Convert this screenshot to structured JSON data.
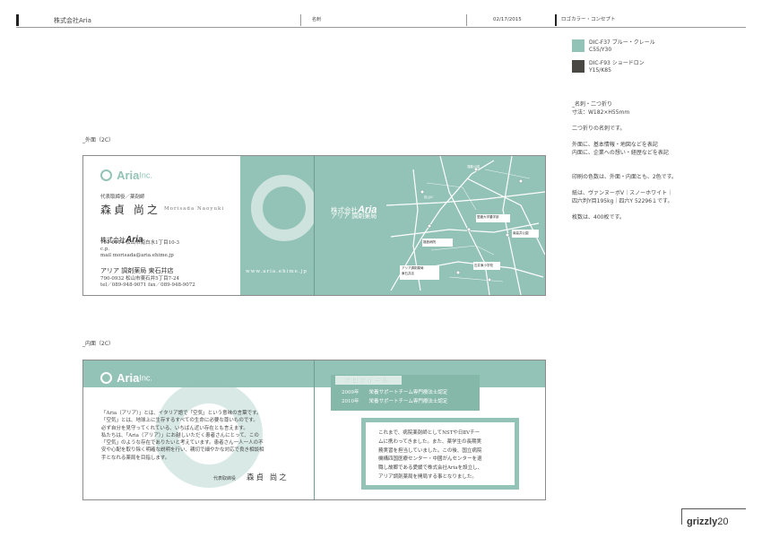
{
  "header": {
    "company": "株式会社Aria",
    "doc_type": "名刺",
    "date": "02/17/2015",
    "section": "ロゴカラー・コンセプト"
  },
  "colors": {
    "swatch1": "#93c2b6",
    "swatch2": "#4a4843",
    "teal": "#93c2b6",
    "teal_dark": "#86b8aa"
  },
  "swatches": [
    {
      "line1": "DIC-F37 ブルー・クレール",
      "line2": "C55/Y30"
    },
    {
      "line1": "DIC-F93 ショードロン",
      "line2": "Y15/K85"
    }
  ],
  "specs": {
    "size_label": "_名刺・二つ折り",
    "size_value": "寸法：W182×H55mm",
    "fold": "二つ折りの名刺です。",
    "outside1": "外面に、基本情報・地図などを表記",
    "inside1": "内面に、企業への想い・経歴などを表記",
    "color_count": "印刷の色数は、外面・内面とも、2色です。",
    "paper1": "紙は、ヴァンヌーボV｜スノーホワイト｜",
    "paper2": "四六判Y目195kg｜四六Y 52296１です。",
    "quantity": "枚数は、400枚です。"
  },
  "outer": {
    "label": "_外面（2C）",
    "logo": "Aria",
    "logo_suffix": "Inc.",
    "title_small": "代表取締役／薬剤師",
    "name": "森貞 尚之",
    "name_roman": "Morisada Naoyuki",
    "company_prefix": "株式会社",
    "company_brand": "Aria",
    "address1": "791-0114 松山市南白水1丁目10-3",
    "address2": "c.p.",
    "address3": "mail  morisada@aria.ehime.jp",
    "pharmacy": "アリア 調剤薬局 東石井店",
    "pharmacy_addr": "790-0932 松山市東石井5丁目7-24",
    "pharmacy_tel": "tel／089-948-9071  fax／089-948-9072",
    "cover_company_prefix": "株式会社",
    "cover_company_brand": "Aria",
    "cover_pharmacy": "アリア 調剤薬局",
    "url": "www.aria.ehime.jp",
    "map_labels": [
      "運動公園",
      "松山IC",
      "愛媛大学農学部",
      "アリア調剤薬局",
      "東石井店",
      "南高井公園",
      "福音病院",
      "石井東小学校"
    ]
  },
  "inner": {
    "label": "_内面（2C）",
    "logo": "Aria",
    "logo_suffix": "Inc.",
    "paragraph": [
      "「Aria（アリア）」とは、イタリア語で「空気」という意味の言葉です。",
      "「空気」とは、地球上に生存するすべての生命に必要な尊いものです。",
      "必ず自分を見守ってくれている、いちばん近い存在とも言えます。",
      "私たちは、「Aria（アリア）」にお越しいただく患者さんにとって、この",
      "「空気」のような存在でありたいと考えています。患者さん一人一人の不",
      "安や心配を取り除く明確な説明を行い、親切で細やかな対応で良き相談相",
      "手となれる薬局を目指します。"
    ],
    "signature_title": "代表取締役",
    "signature_name": "森貞 尚之",
    "profile_title": "プロフィール",
    "profile_items": [
      "2009年　　栄養サポートチーム専門療法士認定",
      "2010年　　栄養サポートチーム専門療法士認定"
    ],
    "bio": [
      "これまで、病院薬剤師としてNSTや日ⅡVチー",
      "ムに携わってきました。また、薬学生の長期実",
      "務実習を担当していました。この後、国立病院",
      "機構四国医療センター・中國がんセンターを退",
      "職し故郷である愛媛で株式会社Ariaを設立し、",
      "アリア調剤薬局を開局する事となりました。"
    ]
  },
  "footer": {
    "brand": "grizzly",
    "page": "20"
  }
}
